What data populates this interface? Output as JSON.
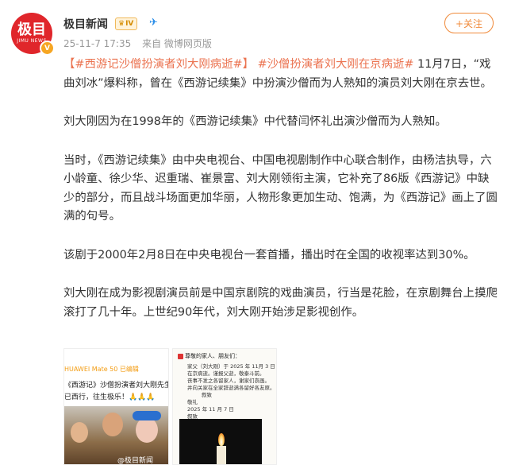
{
  "post": {
    "avatar_text": "极目",
    "avatar_sub": "JIMU NEWS",
    "verified_icon": "V",
    "username": "极目新闻",
    "level_badge": "IV",
    "timestamp": "25-11-7 17:35",
    "source": "来自 微博网页版",
    "follow_label": "+关注"
  },
  "content": {
    "tag1": "【#西游记沙僧扮演者刘大刚病逝#",
    "tag1_close": "】",
    "tag2": "#沙僧扮演者刘大刚在京病逝#",
    "p1_rest": " 11月7日，“戏曲刘冰”爆料称，曾在《西游记续集》中扮演沙僧而为人熟知的演员刘大刚在京去世。",
    "p2": "刘大刚因为在1998年的《西游记续集》中代替闫怀礼出演沙僧而为人熟知。",
    "p3": "当时，《西游记续集》由中央电视台、中国电视剧制作中心联合制作，由杨洁执导，六小龄童、徐少华、迟重瑞、崔景富、刘大刚领衔主演，它补充了86版《西游记》中缺少的部分，而且战斗场面更加华丽，人物形象更加生动、饱满，为《西游记》画上了圆满的句号。",
    "p4": "该剧于2000年2月8日在中央电视台一套首播，播出时在全国的收视率达到30%。",
    "p5": "刘大刚在成为影视剧演员前是中国京剧院的戏曲演员，行当是花脸，在京剧舞台上摸爬滚打了几十年。上世纪90年代，刘大刚开始涉足影视创作。"
  },
  "images": {
    "img1_cap1": "HUAWEI Mate 50 已编辑",
    "img1_cap2": "《西游记》沙僧扮演者刘大刚先生，于2",
    "img1_cap3": "已西行，往生极乐！🙏🙏🙏",
    "img2_header": "尊敬的家人、朋友们：",
    "img2_lines": [
      "家父（刘大刚）于 2025 年 11月 3 日",
      "在京病逝。谨报父逝，敬泰斗前。",
      "丧事不发之各留家人，谢家们哀画。",
      "并向关家在全家辞逝满各留好各友原。",
      "叙致",
      "敬礼",
      "2025 年 11 月 7 日",
      "叙致"
    ],
    "watermark": "@极目新闻"
  },
  "colors": {
    "accent_orange": "#eb7350",
    "follow_orange": "#f08a3a",
    "avatar_red": "#e0262b"
  }
}
